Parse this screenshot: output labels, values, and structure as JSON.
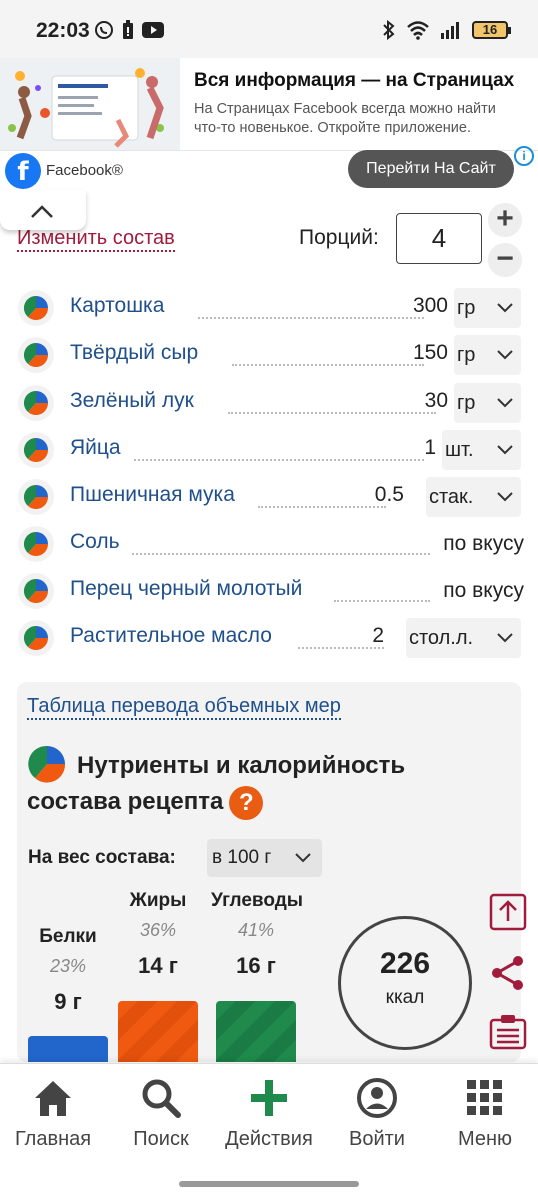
{
  "status_bar": {
    "time": "22:03",
    "battery": "16"
  },
  "ad": {
    "title": "Вся информация — на Страницах",
    "text": "На Страницах Facebook всегда можно найти что-то новенькое. Откройте приложение.",
    "advertiser": "Facebook®",
    "cta": "Перейти На Сайт",
    "info": "i"
  },
  "recipe": {
    "change_label": "Изменить состав",
    "portions_label": "Порций:",
    "portions_value": "4",
    "plus": "+",
    "minus": "−"
  },
  "ingredients": [
    {
      "name": "Картошка",
      "qty": "300",
      "unit": "гр"
    },
    {
      "name": "Твёрдый сыр",
      "qty": "150",
      "unit": "гр"
    },
    {
      "name": "Зелёный лук",
      "qty": "30",
      "unit": "гр"
    },
    {
      "name": "Яйца",
      "qty": "1",
      "unit": "шт."
    },
    {
      "name": "Пшеничная мука",
      "qty": "0.5",
      "unit": "стак."
    },
    {
      "name": "Соль",
      "taste": "по вкусу"
    },
    {
      "name": "Перец черный молотый",
      "taste": "по вкусу"
    },
    {
      "name": "Растительное масло",
      "qty": "2",
      "unit": "стол.л."
    }
  ],
  "nutrients": {
    "convert_link": "Таблица перевода объемных мер",
    "title": "Нутриенты и калорийность состава рецепта",
    "help": "?",
    "weight_label": "На вес состава:",
    "weight_option": "в 100 г",
    "protein": {
      "label": "Белки",
      "pct": "23%",
      "value": "9 г"
    },
    "fat": {
      "label": "Жиры",
      "pct": "36%",
      "value": "14 г"
    },
    "carbs": {
      "label": "Углеводы",
      "pct": "41%",
      "value": "16 г"
    },
    "kcal_value": "226",
    "kcal_unit": "ккал"
  },
  "colors": {
    "protein": "#2266cc",
    "fat": "#f05a10",
    "carbs": "#1f8a4c",
    "accent": "#a11b3c",
    "link": "#20508c"
  },
  "nav": [
    {
      "label": "Главная",
      "icon": "home-icon"
    },
    {
      "label": "Поиск",
      "icon": "search-icon"
    },
    {
      "label": "Действия",
      "icon": "plus-icon"
    },
    {
      "label": "Войти",
      "icon": "user-icon"
    },
    {
      "label": "Меню",
      "icon": "grid-icon"
    }
  ]
}
